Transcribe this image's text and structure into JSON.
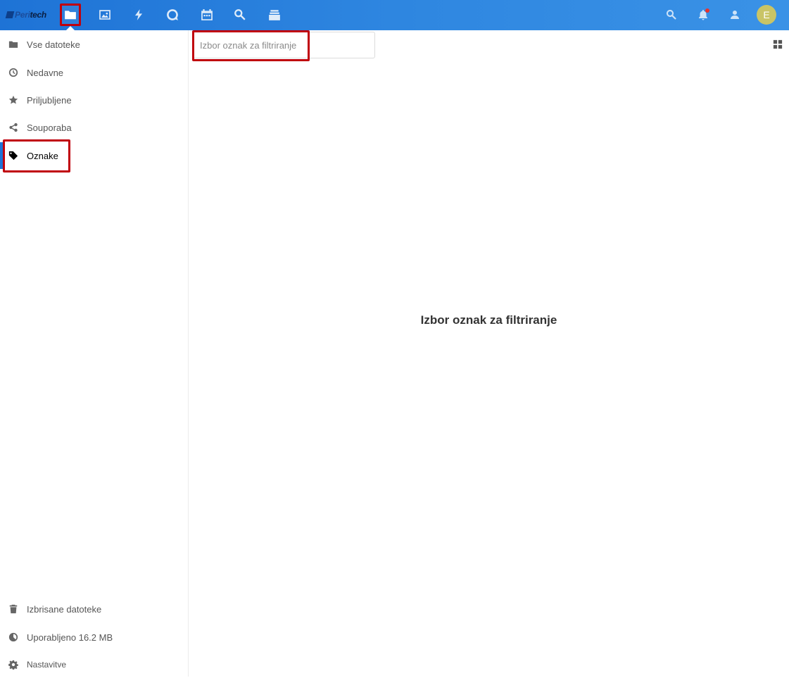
{
  "header": {
    "logo": {
      "part1": "Peri",
      "part2": "tech"
    },
    "apps": [
      {
        "name": "files-icon",
        "label": "Files",
        "active": true
      },
      {
        "name": "gallery-icon",
        "label": "Gallery"
      },
      {
        "name": "activity-icon",
        "label": "Activity"
      },
      {
        "name": "talk-icon",
        "label": "Talk"
      },
      {
        "name": "calendar-icon",
        "label": "Calendar"
      },
      {
        "name": "search-app-icon",
        "label": "Search"
      },
      {
        "name": "deck-icon",
        "label": "Deck"
      }
    ],
    "avatar_initial": "E",
    "accent_color": "#1e73d6",
    "highlight_color": "#c0000c"
  },
  "sidebar": {
    "items": [
      {
        "label": "Vse datoteke",
        "icon": "folder-icon"
      },
      {
        "label": "Nedavne",
        "icon": "clock-icon"
      },
      {
        "label": "Priljubljene",
        "icon": "star-icon"
      },
      {
        "label": "Souporaba",
        "icon": "share-icon"
      },
      {
        "label": "Oznake",
        "icon": "tag-icon",
        "active": true
      }
    ],
    "footer": [
      {
        "label": "Izbrisane datoteke",
        "icon": "trash-icon"
      },
      {
        "label": "Uporabljeno 16.2 MB",
        "icon": "quota-icon"
      },
      {
        "label": "Nastavitve",
        "icon": "gear-icon"
      }
    ]
  },
  "main": {
    "tag_filter_placeholder": "Izbor oznak za filtriranje",
    "empty_message": "Izbor oznak za filtriranje",
    "view_toggle_icon": "grid-view-icon"
  }
}
